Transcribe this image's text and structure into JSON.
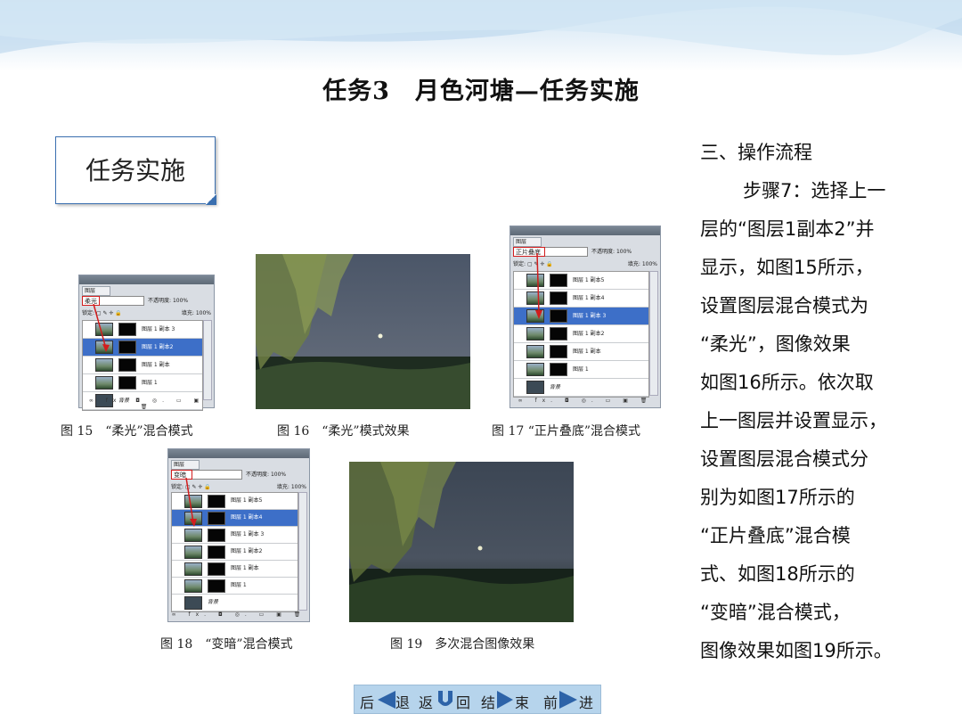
{
  "slide_title": "任务3　月色河塘—任务实施",
  "task_box_label": "任务实施",
  "right_text": {
    "line1": "三、操作流程",
    "line2": "步骤7：选择上一",
    "line3": "层的“图层1副本2”并",
    "line4": "显示，如图15所示，",
    "line5": "设置图层混合模式为",
    "line6": "“柔光”，图像效果",
    "line7": "如图16所示。依次取",
    "line8": "上一图层并设置显示，",
    "line9": "设置图层混合模式分",
    "line10": "别为如图17所示的",
    "line11": "“正片叠底”混合模",
    "line12": "式、如图18所示的",
    "line13": "“变暗”混合模式，",
    "line14": "图像效果如图19所示。"
  },
  "captions": {
    "fig15": "图 15　“柔光”混合模式",
    "fig16": "图 16　“柔光”模式效果",
    "fig17": "图 17 “正片叠底”混合模式",
    "fig18": "图 18　“变暗”混合模式",
    "fig19": "图 19　多次混合图像效果"
  },
  "layers_panel": {
    "tab": "图层",
    "opacity_label": "不透明度:",
    "opacity_value": "100%",
    "lock_label": "锁定:",
    "fill_label": "填充:",
    "fill_value": "100%",
    "background_layer": "背景",
    "bottom_bar": "∞ fx. ◘ ◎. ▭ ▣ 🗑"
  },
  "panel15": {
    "mode": "柔光",
    "layers": [
      "图层 1 副本 3",
      "图层 1 副本2",
      "图层 1 副本",
      "图层 1"
    ],
    "selected_index": 1
  },
  "panel17": {
    "mode": "正片叠底",
    "layers": [
      "图层 1 副本5",
      "图层 1 副本4",
      "图层 1 副本 3",
      "图层 1 副本2",
      "图层 1 副本",
      "图层 1"
    ],
    "selected_index": 2
  },
  "panel18": {
    "mode": "变暗",
    "layers": [
      "图层 1 副本5",
      "图层 1 副本4",
      "图层 1 副本 3",
      "图层 1 副本2",
      "图层 1 副本",
      "图层 1"
    ],
    "selected_index": 1
  },
  "nav": {
    "back": "后",
    "back2": "退",
    "return": "返",
    "return2": "回",
    "end": "结",
    "end2": "束",
    "forward": "前",
    "forward2": "进"
  },
  "colors": {
    "accent": "#3a6fb0",
    "selection": "#3d6fc8",
    "highlight_red": "#d21d1d",
    "nav_bg": "#b6d4ec"
  }
}
